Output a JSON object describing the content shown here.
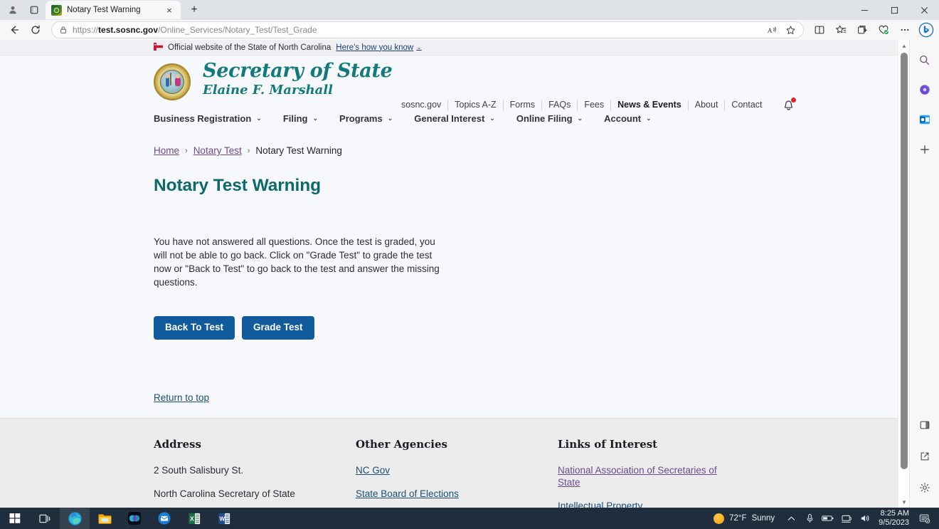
{
  "browser": {
    "tab": {
      "title": "Notary Test Warning",
      "favicon": "nc-seal-favicon",
      "close_label": "×"
    },
    "new_tab_label": "+",
    "address": {
      "url_prefix": "https://",
      "url_domain": "test.sosnc.gov",
      "url_path": "/Online_Services/Notary_Test/Test_Grade"
    },
    "window_controls": {
      "minimize": "—",
      "maximize": "❐",
      "close": "✕"
    },
    "toolbar_icons": [
      "back-icon",
      "refresh-icon",
      "lock-icon",
      "read-aloud-icon",
      "favorite-star-icon",
      "split-screen-icon",
      "favorites-icon",
      "collections-icon",
      "browser-essentials-icon",
      "settings-more-icon",
      "bing-copilot-icon"
    ],
    "sidebar_icons": [
      "search-icon",
      "copilot-icon",
      "outlook-icon",
      "add-icon",
      "sidebar-toggle-icon",
      "open-in-new-window-icon",
      "sidebar-settings-icon"
    ]
  },
  "gov_banner": {
    "icon": "nc-flag-icon",
    "text": "Official website of the State of North Carolina",
    "link": "Here's how you know",
    "caret": "⌄"
  },
  "site_header": {
    "seal_name": "nc-state-seal",
    "brand_line1": "Secretary of State",
    "brand_line2": "Elaine F. Marshall",
    "utility_links": [
      {
        "label": "sosnc.gov",
        "strong": false
      },
      {
        "label": "Topics A-Z",
        "strong": false
      },
      {
        "label": "Forms",
        "strong": false
      },
      {
        "label": "FAQs",
        "strong": false
      },
      {
        "label": "Fees",
        "strong": false
      },
      {
        "label": "News & Events",
        "strong": true
      },
      {
        "label": "About",
        "strong": false
      },
      {
        "label": "Contact",
        "strong": false
      }
    ],
    "notification_icon": "bell-icon",
    "notification_badge_color": "#e02424"
  },
  "main_nav": {
    "items": [
      {
        "label": "Business Registration"
      },
      {
        "label": "Filing"
      },
      {
        "label": "Programs"
      },
      {
        "label": "General Interest"
      },
      {
        "label": "Online Filing"
      },
      {
        "label": "Account"
      }
    ],
    "caret": "⌄"
  },
  "breadcrumb": {
    "items": [
      {
        "label": "Home",
        "current": false
      },
      {
        "label": "Notary Test",
        "current": false
      },
      {
        "label": "Notary Test Warning",
        "current": true
      }
    ],
    "separator": "›"
  },
  "main": {
    "page_title": "Notary Test Warning",
    "body_text": "You have not answered all questions.  Once the test is graded, you will not be able to go back.  Click on \"Grade Test\" to grade the test now or \"Back to Test\" to go back to the test and answer the missing questions.",
    "buttons": [
      {
        "label": "Back To Test",
        "name": "back-to-test-button"
      },
      {
        "label": "Grade Test",
        "name": "grade-test-button"
      }
    ],
    "button_color": "#115b9c",
    "return_to_top": "Return to top"
  },
  "footer": {
    "columns": [
      {
        "heading": "Address",
        "lines": [
          "2 South Salisbury St.",
          "North Carolina Secretary of State"
        ],
        "links": []
      },
      {
        "heading": "Other Agencies",
        "lines": [],
        "links": [
          "NC Gov",
          "State Board of Elections"
        ]
      },
      {
        "heading": "Links of Interest",
        "lines": [],
        "links": [
          "National Association of Secretaries of State",
          "Intellectual Property"
        ]
      }
    ]
  },
  "taskbar": {
    "apps": [
      {
        "name": "start-button",
        "icon": "windows-logo-icon",
        "active": false,
        "running": false
      },
      {
        "name": "task-view-button",
        "icon": "task-view-icon",
        "active": false,
        "running": false
      },
      {
        "name": "taskbar-edge",
        "icon": "edge-icon",
        "active": true,
        "running": true
      },
      {
        "name": "taskbar-file-explorer",
        "icon": "folder-icon",
        "active": false,
        "running": true
      },
      {
        "name": "taskbar-webex",
        "icon": "webex-icon",
        "active": false,
        "running": true
      },
      {
        "name": "taskbar-mail",
        "icon": "mail-icon",
        "active": false,
        "running": true
      },
      {
        "name": "taskbar-excel",
        "icon": "excel-icon",
        "active": false,
        "running": true
      },
      {
        "name": "taskbar-word",
        "icon": "word-icon",
        "active": false,
        "running": true
      }
    ],
    "weather": {
      "temperature": "72°F",
      "condition": "Sunny",
      "icon": "sun-icon"
    },
    "tray_icons": [
      "show-hidden-icons-chevron",
      "microphone-icon",
      "battery-icon",
      "network-icon",
      "volume-icon"
    ],
    "clock": {
      "time": "8:25 AM",
      "date": "9/5/2023"
    },
    "notification_icon": "notification-center-icon"
  }
}
